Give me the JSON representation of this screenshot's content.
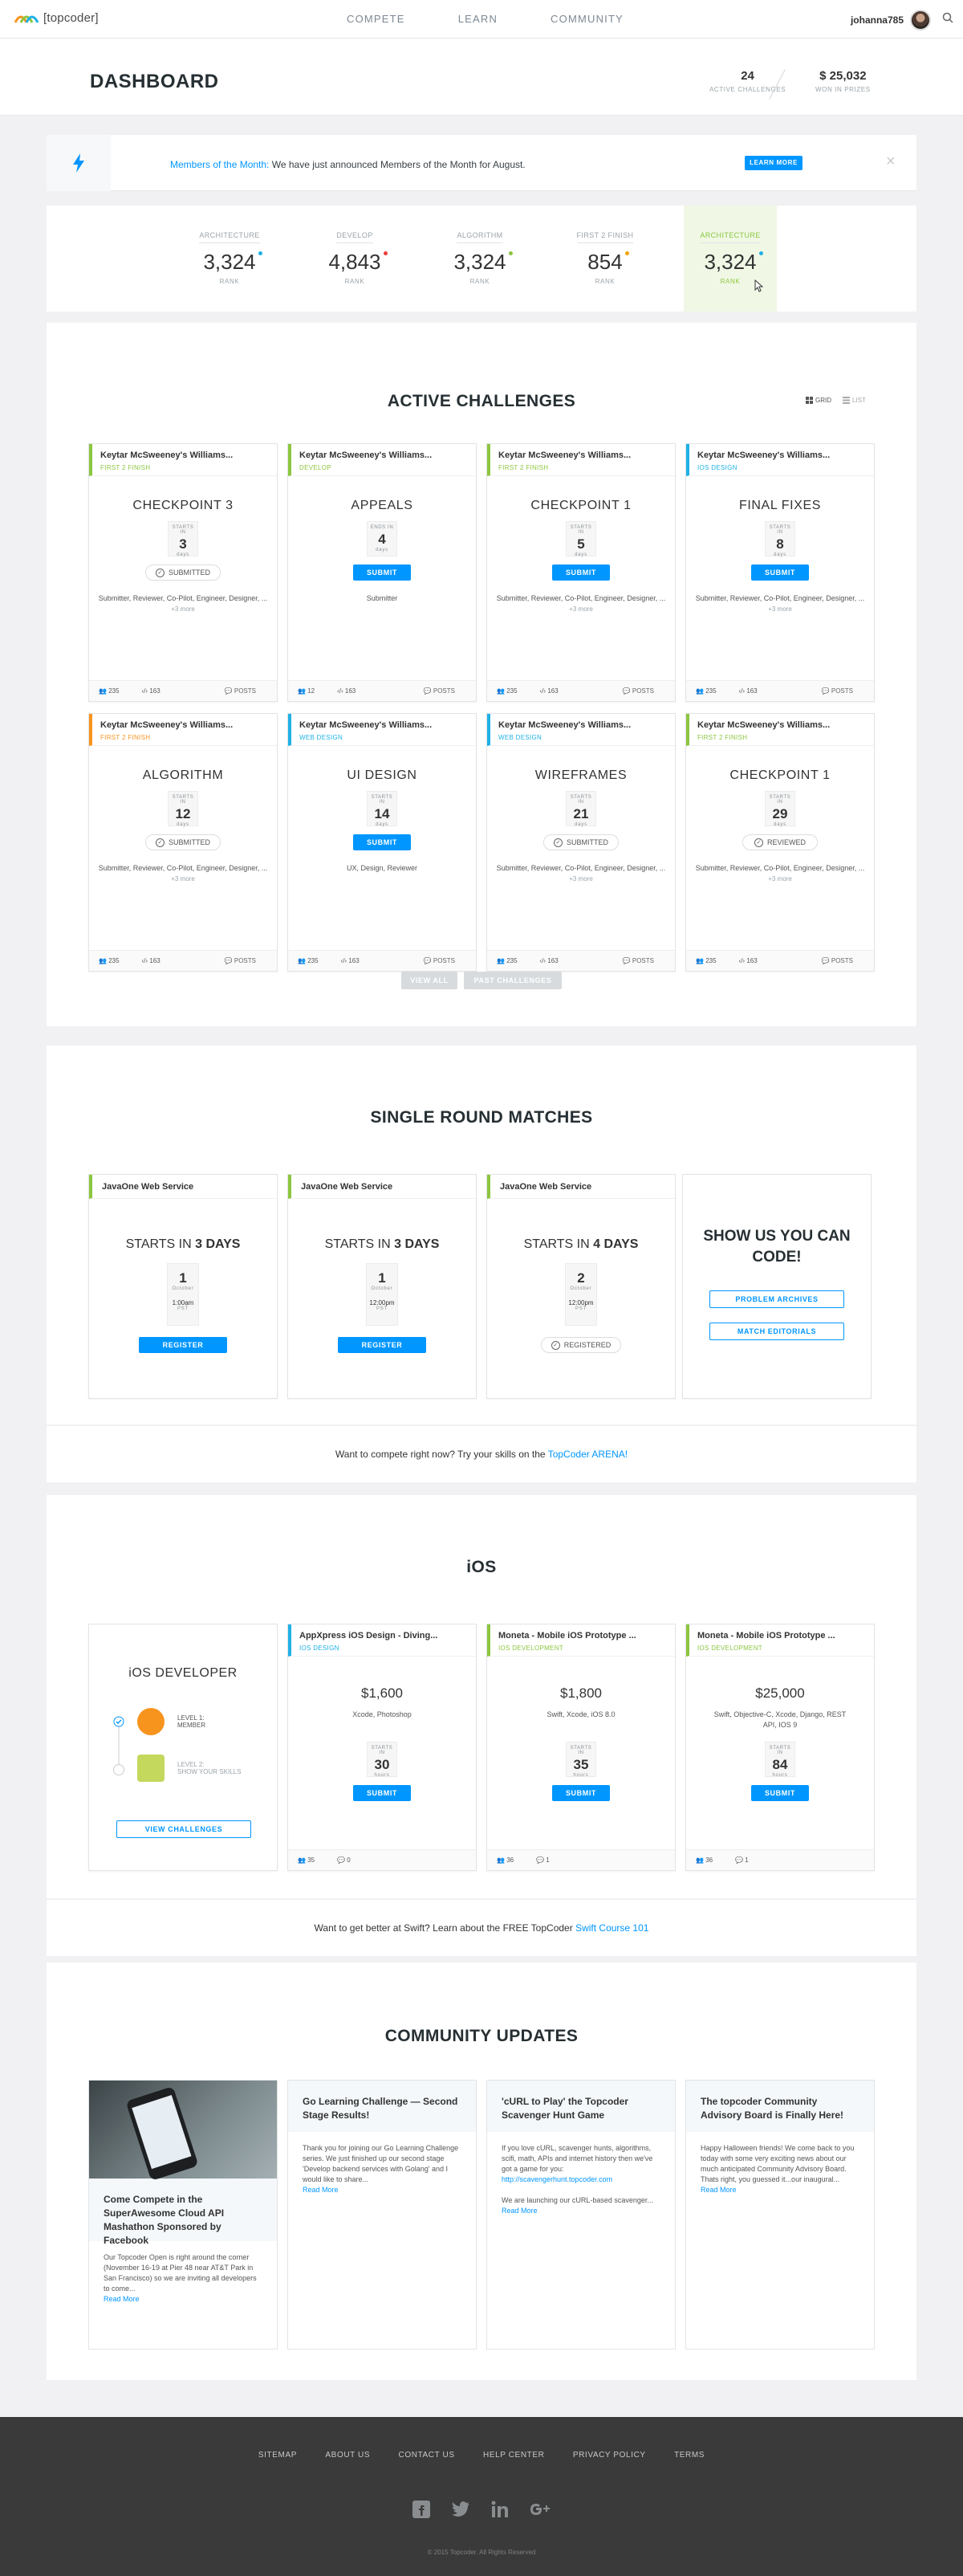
{
  "nav": {
    "logo_text": "[topcoder]",
    "links": [
      "COMPETE",
      "LEARN",
      "COMMUNITY"
    ],
    "username": "johanna785"
  },
  "dashboard": {
    "title": "DASHBOARD",
    "active_challenges": "24",
    "active_challenges_label": "ACTIVE CHALLENGES",
    "won_prizes": "$ 25,032",
    "won_prizes_label": "WON IN PRIZES"
  },
  "notification": {
    "title": "Members of the Month:",
    "text": "We have just announced Members of the Month for August.",
    "button": "LEARN MORE",
    "close": "×"
  },
  "ranks": [
    {
      "track": "ARCHITECTURE",
      "value": "3,324",
      "label": "RANK",
      "dot": "#1eb1e6",
      "selected": false
    },
    {
      "track": "DEVELOP",
      "value": "4,843",
      "label": "RANK",
      "dot": "#ef3a3a",
      "selected": false
    },
    {
      "track": "ALGORITHM",
      "value": "3,324",
      "label": "RANK",
      "dot": "#8cc63f",
      "selected": false
    },
    {
      "track": "FIRST 2 FINISH",
      "value": "854",
      "label": "RANK",
      "dot": "#f0a400",
      "selected": false
    },
    {
      "track": "ARCHITECTURE",
      "value": "3,324",
      "label": "RANK",
      "dot": "#1eb1e6",
      "selected": true
    }
  ],
  "active": {
    "title": "ACTIVE CHALLENGES",
    "grid_label": "GRID",
    "list_label": "LIST",
    "view_all": "VIEW ALL",
    "past": "PAST CHALLENGES",
    "cards": [
      {
        "name": "Keytar McSweeney's Williams...",
        "track": "FIRST 2 FINISH",
        "color": "#8cc63f",
        "title": "CHECKPOINT 3",
        "box_top": "STARTS IN",
        "num": "3",
        "unit": "days",
        "action": "SUBMITTED",
        "roles": "Submitter, Reviewer, Co-Pilot, Engineer, Designer, ...",
        "more": "+3 more",
        "reg": "235",
        "subs": "163",
        "posts": "POSTS"
      },
      {
        "name": "Keytar McSweeney's Williams...",
        "track": "DEVELOP",
        "color": "#8cc63f",
        "title": "APPEALS",
        "box_top": "ENDS IN",
        "num": "4",
        "unit": "days",
        "action": "SUBMIT",
        "roles": "Submitter",
        "more": "",
        "reg": "12",
        "subs": "163",
        "posts": "POSTS"
      },
      {
        "name": "Keytar McSweeney's Williams...",
        "track": "FIRST 2 FINISH",
        "color": "#8cc63f",
        "title": "CHECKPOINT 1",
        "box_top": "STARTS IN",
        "num": "5",
        "unit": "days",
        "action": "SUBMIT",
        "roles": "Submitter, Reviewer, Co-Pilot, Engineer, Designer, ...",
        "more": "+3 more",
        "reg": "235",
        "subs": "163",
        "posts": "POSTS"
      },
      {
        "name": "Keytar McSweeney's Williams...",
        "track": "IOS DESIGN",
        "color": "#1eb1e6",
        "title": "FINAL FIXES",
        "box_top": "STARTS IN",
        "num": "8",
        "unit": "days",
        "action": "SUBMIT",
        "roles": "Submitter, Reviewer, Co-Pilot, Engineer, Designer, ...",
        "more": "+3 more",
        "reg": "235",
        "subs": "163",
        "posts": "POSTS"
      },
      {
        "name": "Keytar McSweeney's Williams...",
        "track": "FIRST 2 FINISH",
        "color": "#f7941e",
        "title": "ALGORITHM",
        "box_top": "STARTS IN",
        "num": "12",
        "unit": "days",
        "action": "SUBMITTED",
        "roles": "Submitter, Reviewer, Co-Pilot, Engineer, Designer, ...",
        "more": "+3 more",
        "reg": "235",
        "subs": "163",
        "posts": "POSTS"
      },
      {
        "name": "Keytar McSweeney's Williams...",
        "track": "WEB DESIGN",
        "color": "#1eb1e6",
        "title": "UI DESIGN",
        "box_top": "STARTS IN",
        "num": "14",
        "unit": "days",
        "action": "SUBMIT",
        "roles": "UX, Design, Reviewer",
        "more": "",
        "reg": "235",
        "subs": "163",
        "posts": "POSTS"
      },
      {
        "name": "Keytar McSweeney's Williams...",
        "track": "WEB DESIGN",
        "color": "#1eb1e6",
        "title": "WIREFRAMES",
        "box_top": "STARTS IN",
        "num": "21",
        "unit": "days",
        "action": "SUBMITTED",
        "roles": "Submitter, Reviewer, Co-Pilot, Engineer, Designer, ...",
        "more": "+3 more",
        "reg": "235",
        "subs": "163",
        "posts": "POSTS"
      },
      {
        "name": "Keytar McSweeney's Williams...",
        "track": "FIRST 2 FINISH",
        "color": "#8cc63f",
        "title": "CHECKPOINT 1",
        "box_top": "STARTS IN",
        "num": "29",
        "unit": "days",
        "action": "REVIEWED",
        "roles": "Submitter, Reviewer, Co-Pilot, Engineer, Designer, ...",
        "more": "+3 more",
        "reg": "235",
        "subs": "163",
        "posts": "POSTS"
      }
    ]
  },
  "srm": {
    "title": "SINGLE ROUND MATCHES",
    "cards": [
      {
        "name": "JavaOne Web Service",
        "starts": "STARTS IN",
        "days": "3 DAYS",
        "day": "1",
        "month": "October",
        "time": "1:00am",
        "tz": "PST",
        "action": "REGISTER"
      },
      {
        "name": "JavaOne Web Service",
        "starts": "STARTS IN",
        "days": "3 DAYS",
        "day": "1",
        "month": "October",
        "time": "12:00pm",
        "tz": "PST",
        "action": "REGISTER"
      },
      {
        "name": "JavaOne Web Service",
        "starts": "STARTS IN",
        "days": "4 DAYS",
        "day": "2",
        "month": "October",
        "time": "12:00pm",
        "tz": "PST",
        "action": "REGISTERED"
      }
    ],
    "cta_line1": "SHOW US YOU CAN",
    "cta_line2": "CODE!",
    "problem_archives": "PROBLEM ARCHIVES",
    "match_editorials": "MATCH EDITORIALS",
    "tag_text": "Want to compete right now? Try your skills on the",
    "tag_link": "TopCoder ARENA!"
  },
  "ios": {
    "title": "iOS",
    "dev_title": "iOS DEVELOPER",
    "level1": "LEVEL 1:",
    "level1_name": "MEMBER",
    "level2": "LEVEL 2:",
    "level2_name": "SHOW YOUR SKILLS",
    "view": "VIEW CHALLENGES",
    "cards": [
      {
        "name": "AppXpress iOS Design - Diving...",
        "track": "IOS DESIGN",
        "color": "#1eb1e6",
        "prize": "$1,600",
        "tech": "Xcode, Photoshop",
        "box_top": "STARTS IN",
        "num": "30",
        "unit": "hours",
        "action": "SUBMIT",
        "reg": "35",
        "subs": "0"
      },
      {
        "name": "Moneta - Mobile iOS Prototype ...",
        "track": "IOS DEVELOPMENT",
        "color": "#8cc63f",
        "prize": "$1,800",
        "tech": "Swift, Xcode, iOS 8.0",
        "box_top": "STARTS IN",
        "num": "35",
        "unit": "hours",
        "action": "SUBMIT",
        "reg": "36",
        "subs": "1"
      },
      {
        "name": "Moneta - Mobile iOS Prototype ...",
        "track": "IOS DEVELOPMENT",
        "color": "#8cc63f",
        "prize": "$25,000",
        "tech": "Swift, Objective-C, Xcode, Django, REST API, IOS 9",
        "box_top": "STARTS IN",
        "num": "84",
        "unit": "hours",
        "action": "SUBMIT",
        "reg": "36",
        "subs": "1"
      }
    ],
    "tag_text": "Want to get better at Swift? Learn about the FREE TopCoder",
    "tag_link": "Swift Course 101"
  },
  "community": {
    "title": "COMMUNITY UPDATES",
    "posts": [
      {
        "title": "Come Compete in the SuperAwesome Cloud API Mashathon Sponsored by Facebook",
        "body": "Our Topcoder Open is right around the corner (November 16-19 at Pier 48 near AT&T Park in San Francisco) so we are inviting all developers to come...",
        "link": "",
        "body2": "",
        "more": "Read More"
      },
      {
        "title": "Go Learning Challenge — Second Stage Results!",
        "body": "Thank you for joining our Go Learning Challenge series. We just finished up our second stage 'Develop backend services with Golang' and I would like to share...",
        "link": "",
        "body2": "",
        "more": "Read More"
      },
      {
        "title": "'cURL to Play' the Topcoder Scavenger Hunt Game",
        "body": "If you love cURL, scavenger hunts, algorithms, scifi, math, APIs and internet history then we've got a game for you:",
        "link": "http://scavengerhunt.topcoder.com",
        "body2": "We are launching our cURL-based scavenger...",
        "more": "Read More"
      },
      {
        "title": "The topcoder Community Advisory Board is Finally Here!",
        "body": "Happy Halloween friends! We come back to you today with some very exciting news about our much anticipated Community Advisory Board. Thats right, you guessed it...our inaugural...",
        "link": "",
        "body2": "",
        "more": "Read More"
      }
    ]
  },
  "footer": {
    "links": [
      "SITEMAP",
      "ABOUT US",
      "CONTACT US",
      "HELP CENTER",
      "PRIVACY POLICY",
      "TERMS"
    ],
    "copyright": "© 2015 Topcoder. All Rights Reserved"
  }
}
